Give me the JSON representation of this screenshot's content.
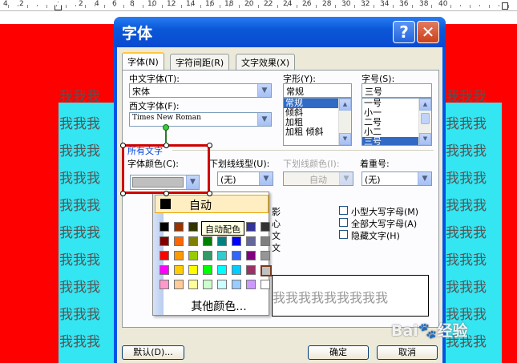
{
  "ruler": {
    "numbers": [
      "4",
      "2",
      "2",
      "4",
      "6",
      "8",
      "10",
      "12",
      "14",
      "16",
      "18",
      "20",
      "22",
      "24",
      "26",
      "28",
      "30",
      "32",
      "34",
      "36",
      "38",
      "40"
    ]
  },
  "document": {
    "row_text": "我我我",
    "preview_row_text": "我我我我我我我我我",
    "bg_color": "#ff0000",
    "highlight_color": "#33e6f2"
  },
  "dialog": {
    "title": "字体",
    "help_glyph": "?",
    "close_glyph": "✕",
    "tabs": [
      {
        "label": "字体(N)",
        "active": true
      },
      {
        "label": "字符间距(R)",
        "active": false
      },
      {
        "label": "文字效果(X)",
        "active": false
      }
    ],
    "chinese_font": {
      "label": "中文字体(T):",
      "value": "宋体"
    },
    "western_font": {
      "label": "西文字体(F):",
      "value": "Times New Roman"
    },
    "style": {
      "label": "字形(Y):",
      "value": "常规",
      "options": [
        "常规",
        "倾斜",
        "加粗",
        "加粗 倾斜"
      ],
      "selected": "常规"
    },
    "size": {
      "label": "字号(S):",
      "value": "三号",
      "options": [
        "一号",
        "小一",
        "二号",
        "小二",
        "三号"
      ],
      "selected": "三号"
    },
    "all_text": {
      "group_label": "所有文字"
    },
    "font_color": {
      "label": "字体颜色(C):"
    },
    "underline_style": {
      "label": "下划线线型(U):",
      "value": "(无)"
    },
    "underline_color": {
      "label": "下划线颜色(I):",
      "value": "自动"
    },
    "emphasis": {
      "label": "着重号:",
      "value": "(无)"
    },
    "effects": {
      "partial_labels": [
        "影",
        "心",
        "文",
        "文"
      ],
      "checkboxes": [
        {
          "label": "小型大写字母(M)",
          "checked": false
        },
        {
          "label": "全部大写字母(A)",
          "checked": false
        },
        {
          "label": "隐藏文字(H)",
          "checked": false
        }
      ]
    },
    "buttons": {
      "default": "默认(D)...",
      "ok": "确定",
      "cancel": "取消"
    }
  },
  "color_popup": {
    "auto_label": "自动",
    "tooltip": "自动配色",
    "more_colors": "其他颜色...",
    "swatch_rows": [
      [
        "#000000",
        "#993300",
        "#333300",
        "#003300",
        "#003366",
        "#000080",
        "#333399",
        "#333333"
      ],
      [
        "#800000",
        "#ff6600",
        "#808000",
        "#008000",
        "#008080",
        "#0000ff",
        "#666699",
        "#808080"
      ],
      [
        "#ff0000",
        "#ff9900",
        "#99cc00",
        "#339966",
        "#33cccc",
        "#3366ff",
        "#800080",
        "#969696"
      ],
      [
        "#ff00ff",
        "#ffcc00",
        "#ffff00",
        "#00ff00",
        "#00ffff",
        "#00ccff",
        "#993366",
        "#c0c0c0"
      ],
      [
        "#ff99cc",
        "#ffcc99",
        "#ffff99",
        "#ccffcc",
        "#ccffff",
        "#99ccff",
        "#cc99ff",
        "#ffffff"
      ]
    ]
  },
  "watermark": {
    "brand": "Bai",
    "brand2": "经验"
  }
}
